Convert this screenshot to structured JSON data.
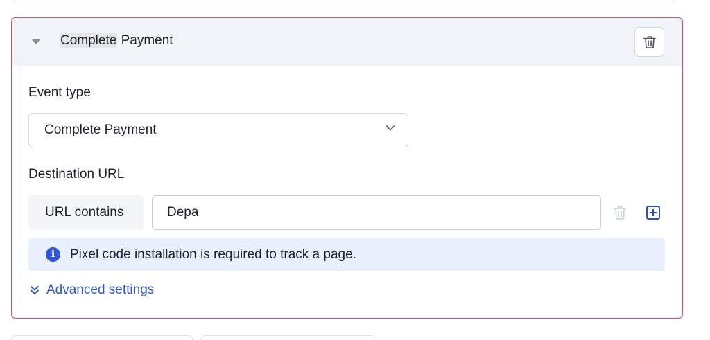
{
  "card": {
    "title_highlight": "Complete",
    "title_rest": " Payment",
    "border_color": "#e8476a"
  },
  "event_type": {
    "label": "Event type",
    "selected": "Complete Payment"
  },
  "destination": {
    "label": "Destination URL",
    "condition": "URL contains",
    "value": "Depa"
  },
  "info": {
    "text": "Pixel code installation is required to track a page."
  },
  "advanced": {
    "label": "Advanced settings"
  },
  "icons": {
    "header_caret": "caret-down-icon",
    "delete": "trash-icon",
    "select_chevron": "chevron-down-icon",
    "row_delete": "trash-icon",
    "row_add": "plus-square-icon",
    "info": "info-icon",
    "advanced": "double-chevron-down-icon"
  },
  "colors": {
    "accent": "#2f57d6",
    "link": "#3256c7",
    "info_bg": "#e8f0fd",
    "header_bg": "#f1f4f8"
  }
}
